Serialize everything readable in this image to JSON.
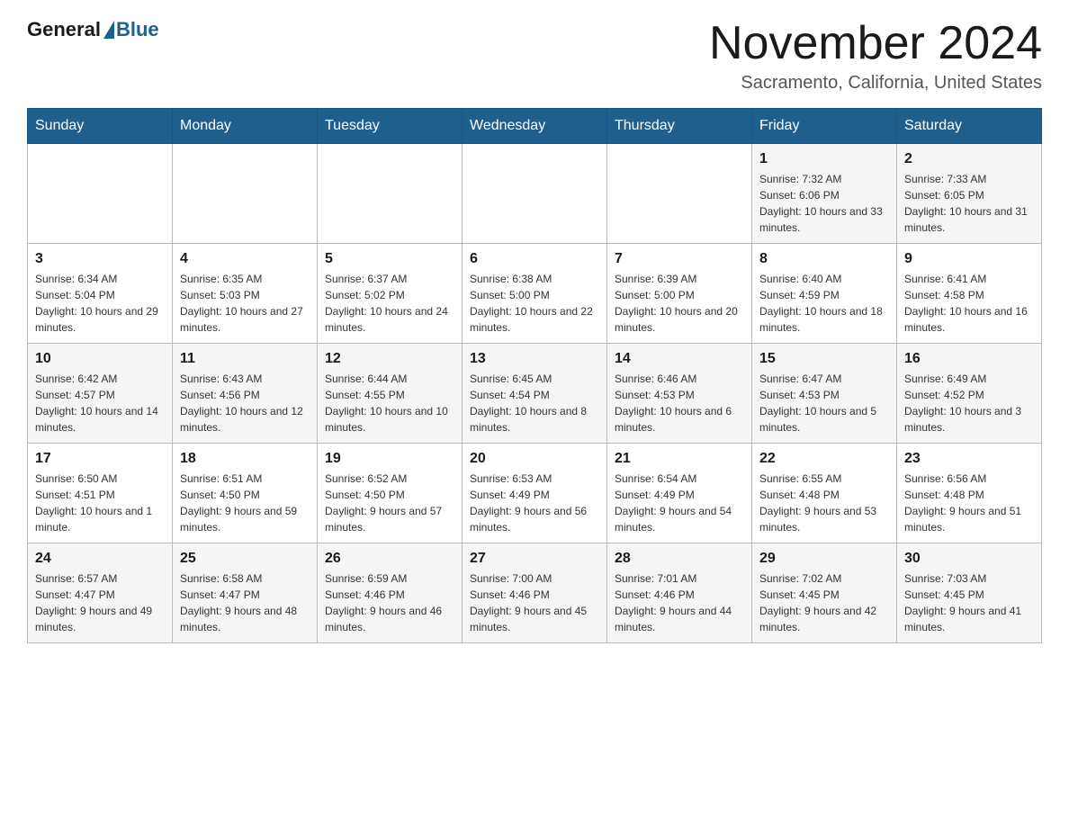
{
  "header": {
    "logo_general": "General",
    "logo_blue": "Blue",
    "month_title": "November 2024",
    "location": "Sacramento, California, United States"
  },
  "days_of_week": [
    "Sunday",
    "Monday",
    "Tuesday",
    "Wednesday",
    "Thursday",
    "Friday",
    "Saturday"
  ],
  "weeks": [
    [
      {
        "day": "",
        "info": ""
      },
      {
        "day": "",
        "info": ""
      },
      {
        "day": "",
        "info": ""
      },
      {
        "day": "",
        "info": ""
      },
      {
        "day": "",
        "info": ""
      },
      {
        "day": "1",
        "info": "Sunrise: 7:32 AM\nSunset: 6:06 PM\nDaylight: 10 hours and 33 minutes."
      },
      {
        "day": "2",
        "info": "Sunrise: 7:33 AM\nSunset: 6:05 PM\nDaylight: 10 hours and 31 minutes."
      }
    ],
    [
      {
        "day": "3",
        "info": "Sunrise: 6:34 AM\nSunset: 5:04 PM\nDaylight: 10 hours and 29 minutes."
      },
      {
        "day": "4",
        "info": "Sunrise: 6:35 AM\nSunset: 5:03 PM\nDaylight: 10 hours and 27 minutes."
      },
      {
        "day": "5",
        "info": "Sunrise: 6:37 AM\nSunset: 5:02 PM\nDaylight: 10 hours and 24 minutes."
      },
      {
        "day": "6",
        "info": "Sunrise: 6:38 AM\nSunset: 5:00 PM\nDaylight: 10 hours and 22 minutes."
      },
      {
        "day": "7",
        "info": "Sunrise: 6:39 AM\nSunset: 5:00 PM\nDaylight: 10 hours and 20 minutes."
      },
      {
        "day": "8",
        "info": "Sunrise: 6:40 AM\nSunset: 4:59 PM\nDaylight: 10 hours and 18 minutes."
      },
      {
        "day": "9",
        "info": "Sunrise: 6:41 AM\nSunset: 4:58 PM\nDaylight: 10 hours and 16 minutes."
      }
    ],
    [
      {
        "day": "10",
        "info": "Sunrise: 6:42 AM\nSunset: 4:57 PM\nDaylight: 10 hours and 14 minutes."
      },
      {
        "day": "11",
        "info": "Sunrise: 6:43 AM\nSunset: 4:56 PM\nDaylight: 10 hours and 12 minutes."
      },
      {
        "day": "12",
        "info": "Sunrise: 6:44 AM\nSunset: 4:55 PM\nDaylight: 10 hours and 10 minutes."
      },
      {
        "day": "13",
        "info": "Sunrise: 6:45 AM\nSunset: 4:54 PM\nDaylight: 10 hours and 8 minutes."
      },
      {
        "day": "14",
        "info": "Sunrise: 6:46 AM\nSunset: 4:53 PM\nDaylight: 10 hours and 6 minutes."
      },
      {
        "day": "15",
        "info": "Sunrise: 6:47 AM\nSunset: 4:53 PM\nDaylight: 10 hours and 5 minutes."
      },
      {
        "day": "16",
        "info": "Sunrise: 6:49 AM\nSunset: 4:52 PM\nDaylight: 10 hours and 3 minutes."
      }
    ],
    [
      {
        "day": "17",
        "info": "Sunrise: 6:50 AM\nSunset: 4:51 PM\nDaylight: 10 hours and 1 minute."
      },
      {
        "day": "18",
        "info": "Sunrise: 6:51 AM\nSunset: 4:50 PM\nDaylight: 9 hours and 59 minutes."
      },
      {
        "day": "19",
        "info": "Sunrise: 6:52 AM\nSunset: 4:50 PM\nDaylight: 9 hours and 57 minutes."
      },
      {
        "day": "20",
        "info": "Sunrise: 6:53 AM\nSunset: 4:49 PM\nDaylight: 9 hours and 56 minutes."
      },
      {
        "day": "21",
        "info": "Sunrise: 6:54 AM\nSunset: 4:49 PM\nDaylight: 9 hours and 54 minutes."
      },
      {
        "day": "22",
        "info": "Sunrise: 6:55 AM\nSunset: 4:48 PM\nDaylight: 9 hours and 53 minutes."
      },
      {
        "day": "23",
        "info": "Sunrise: 6:56 AM\nSunset: 4:48 PM\nDaylight: 9 hours and 51 minutes."
      }
    ],
    [
      {
        "day": "24",
        "info": "Sunrise: 6:57 AM\nSunset: 4:47 PM\nDaylight: 9 hours and 49 minutes."
      },
      {
        "day": "25",
        "info": "Sunrise: 6:58 AM\nSunset: 4:47 PM\nDaylight: 9 hours and 48 minutes."
      },
      {
        "day": "26",
        "info": "Sunrise: 6:59 AM\nSunset: 4:46 PM\nDaylight: 9 hours and 46 minutes."
      },
      {
        "day": "27",
        "info": "Sunrise: 7:00 AM\nSunset: 4:46 PM\nDaylight: 9 hours and 45 minutes."
      },
      {
        "day": "28",
        "info": "Sunrise: 7:01 AM\nSunset: 4:46 PM\nDaylight: 9 hours and 44 minutes."
      },
      {
        "day": "29",
        "info": "Sunrise: 7:02 AM\nSunset: 4:45 PM\nDaylight: 9 hours and 42 minutes."
      },
      {
        "day": "30",
        "info": "Sunrise: 7:03 AM\nSunset: 4:45 PM\nDaylight: 9 hours and 41 minutes."
      }
    ]
  ]
}
